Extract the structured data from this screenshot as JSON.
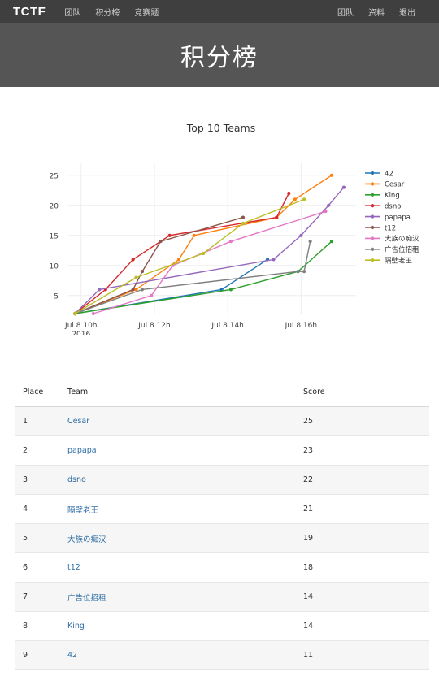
{
  "navbar": {
    "brand": "TCTF",
    "left_links": [
      "团队",
      "积分榜",
      "竞赛题"
    ],
    "right_links": [
      "团队",
      "资料",
      "退出"
    ]
  },
  "header": {
    "title": "积分榜"
  },
  "chart_data": {
    "type": "line",
    "title": "Top 10 Teams",
    "x_ticks": [
      "Jul 8 10h\n2016",
      "Jul 8 12h",
      "Jul 8 14h",
      "Jul 8 16h"
    ],
    "y_ticks": [
      5,
      10,
      15,
      20,
      25
    ],
    "ylim": [
      2,
      27
    ],
    "xlim": [
      "2016-07-08 09:39",
      "2016-07-08 17:30"
    ],
    "legend_position": "right",
    "grid": true,
    "series": [
      {
        "name": "42",
        "color": "#1f77b4",
        "x": [
          "2016-07-08 09:50",
          "2016-07-08 13:50",
          "2016-07-08 15:05"
        ],
        "y": [
          2,
          6,
          11
        ]
      },
      {
        "name": "Cesar",
        "color": "#ff7f0e",
        "x": [
          "2016-07-08 09:50",
          "2016-07-08 11:30",
          "2016-07-08 12:40",
          "2016-07-08 13:05",
          "2016-07-08 15:20",
          "2016-07-08 15:50",
          "2016-07-08 16:50"
        ],
        "y": [
          2,
          6,
          11,
          15,
          18,
          21,
          25
        ]
      },
      {
        "name": "King",
        "color": "#2ca02c",
        "x": [
          "2016-07-08 09:50",
          "2016-07-08 14:05",
          "2016-07-08 15:55",
          "2016-07-08 16:50"
        ],
        "y": [
          2,
          6,
          9,
          14
        ]
      },
      {
        "name": "dsno",
        "color": "#d62728",
        "x": [
          "2016-07-08 09:50",
          "2016-07-08 10:40",
          "2016-07-08 11:25",
          "2016-07-08 12:25",
          "2016-07-08 15:20",
          "2016-07-08 15:40"
        ],
        "y": [
          2,
          6,
          11,
          15,
          18,
          22
        ]
      },
      {
        "name": "papapa",
        "color": "#9467bd",
        "x": [
          "2016-07-08 09:50",
          "2016-07-08 10:30",
          "2016-07-08 15:15",
          "2016-07-08 16:00",
          "2016-07-08 16:45",
          "2016-07-08 17:10"
        ],
        "y": [
          2,
          6,
          11,
          15,
          20,
          23
        ]
      },
      {
        "name": "t12",
        "color": "#8c564b",
        "x": [
          "2016-07-08 09:50",
          "2016-07-08 11:25",
          "2016-07-08 11:40",
          "2016-07-08 12:10",
          "2016-07-08 14:25"
        ],
        "y": [
          2,
          6,
          9,
          14,
          18
        ]
      },
      {
        "name": "大族の痴汉",
        "color": "#e377c2",
        "x": [
          "2016-07-08 10:20",
          "2016-07-08 11:55",
          "2016-07-08 12:30",
          "2016-07-08 14:05",
          "2016-07-08 16:40"
        ],
        "y": [
          2,
          5,
          10,
          14,
          19
        ]
      },
      {
        "name": "广告位招租",
        "color": "#7f7f7f",
        "x": [
          "2016-07-08 09:50",
          "2016-07-08 11:40",
          "2016-07-08 15:55",
          "2016-07-08 16:05",
          "2016-07-08 16:15"
        ],
        "y": [
          2,
          6,
          9,
          9,
          14
        ]
      },
      {
        "name": "隔壁老王",
        "color": "#bcbd22",
        "x": [
          "2016-07-08 09:50",
          "2016-07-08 11:30",
          "2016-07-08 13:20",
          "2016-07-08 14:25",
          "2016-07-08 16:05"
        ],
        "y": [
          2,
          8,
          12,
          17,
          21
        ]
      }
    ]
  },
  "table": {
    "headers": [
      "Place",
      "Team",
      "Score"
    ],
    "rows": [
      {
        "place": "1",
        "team": "Cesar",
        "score": "25"
      },
      {
        "place": "2",
        "team": "papapa",
        "score": "23"
      },
      {
        "place": "3",
        "team": "dsno",
        "score": "22"
      },
      {
        "place": "4",
        "team": "隔壁老王",
        "score": "21"
      },
      {
        "place": "5",
        "team": "大族の痴汉",
        "score": "19"
      },
      {
        "place": "6",
        "team": "t12",
        "score": "18"
      },
      {
        "place": "7",
        "team": "广告位招租",
        "score": "14"
      },
      {
        "place": "8",
        "team": "King",
        "score": "14"
      },
      {
        "place": "9",
        "team": "42",
        "score": "11"
      }
    ]
  }
}
